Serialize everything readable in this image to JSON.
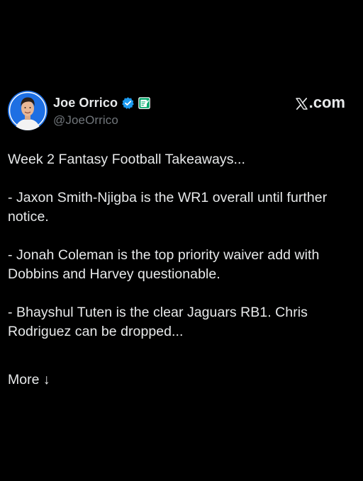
{
  "author": {
    "name": "Joe Orrico",
    "handle": "@JoeOrrico",
    "verified_icon": "verified-badge-icon",
    "affiliate_icon": "notepad-affiliate-icon"
  },
  "brand": {
    "site": ".com",
    "logo_icon": "x-logo-icon"
  },
  "post": {
    "lines": [
      "Week 2 Fantasy Football Takeaways...",
      "- Jaxon Smith-Njigba is the WR1 overall until further notice.",
      "- Jonah Coleman is the top priority waiver add with Dobbins and Harvey questionable.",
      "- Bhayshul Tuten is the clear Jaguars RB1. Chris Rodriguez can be dropped..."
    ],
    "more_label": "More ↓"
  },
  "colors": {
    "background": "#000000",
    "text": "#e7e9ea",
    "muted": "#71767b",
    "verified": "#1d9bf0",
    "affiliate": "#00ba7c"
  }
}
